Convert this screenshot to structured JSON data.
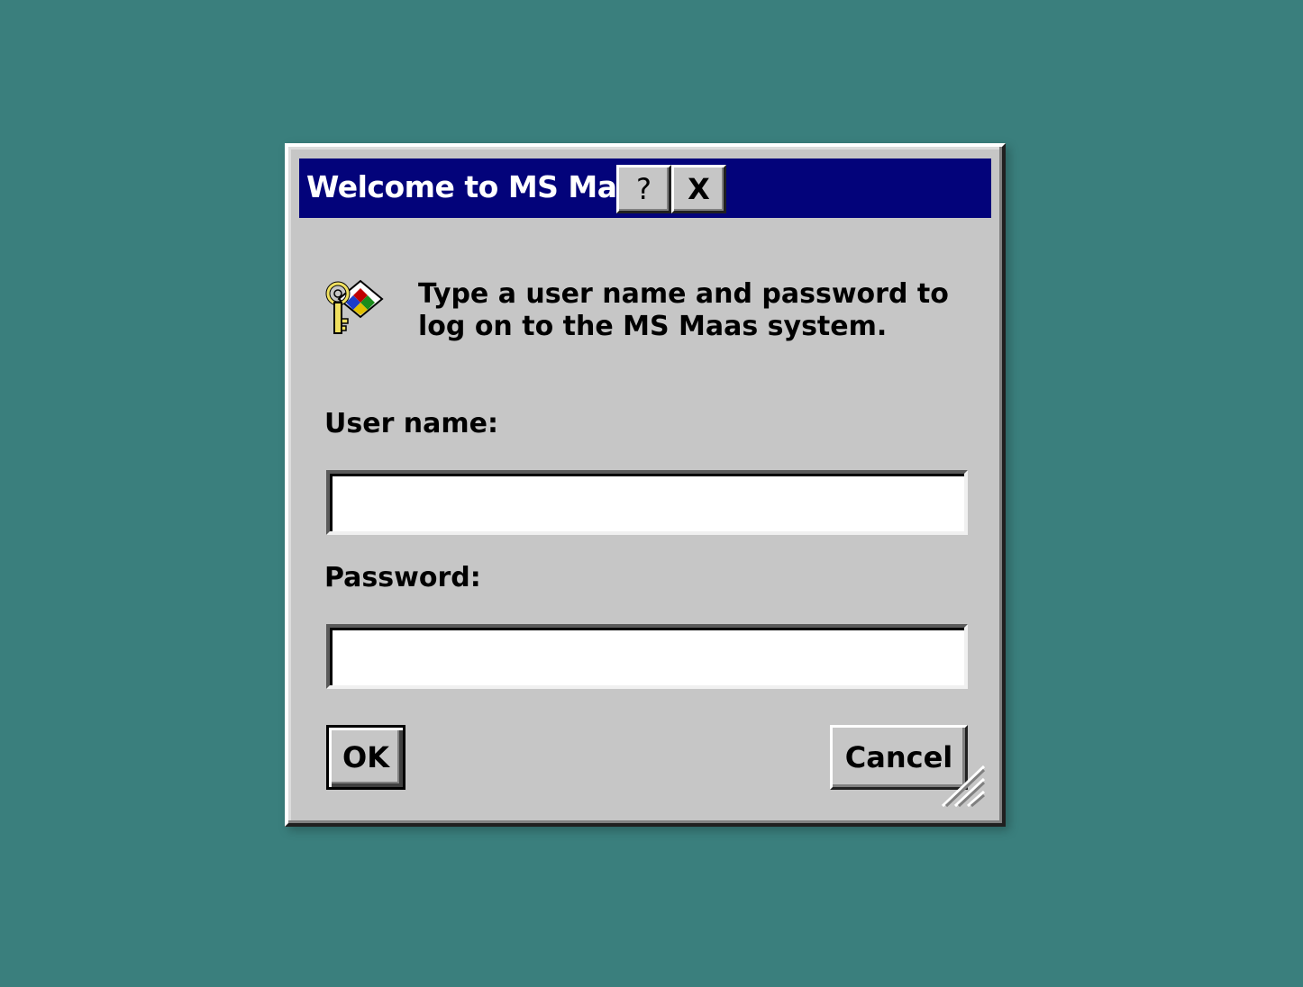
{
  "window": {
    "title": "Welcome to MS Maas",
    "help_button": "?",
    "close_button": "X"
  },
  "message": {
    "line1": "Type a user name and password to",
    "line2": "log on to the MS Maas system."
  },
  "form": {
    "username_label": "User name:",
    "username_value": "",
    "password_label": "Password:",
    "password_value": ""
  },
  "buttons": {
    "ok": "OK",
    "cancel": "Cancel"
  },
  "icons": {
    "login": "key-icon",
    "resize": "resize-grip-icon"
  },
  "colors": {
    "desktop": "#3a7f7d",
    "titlebar": "#03037a",
    "dialog": "#c6c6c6"
  }
}
